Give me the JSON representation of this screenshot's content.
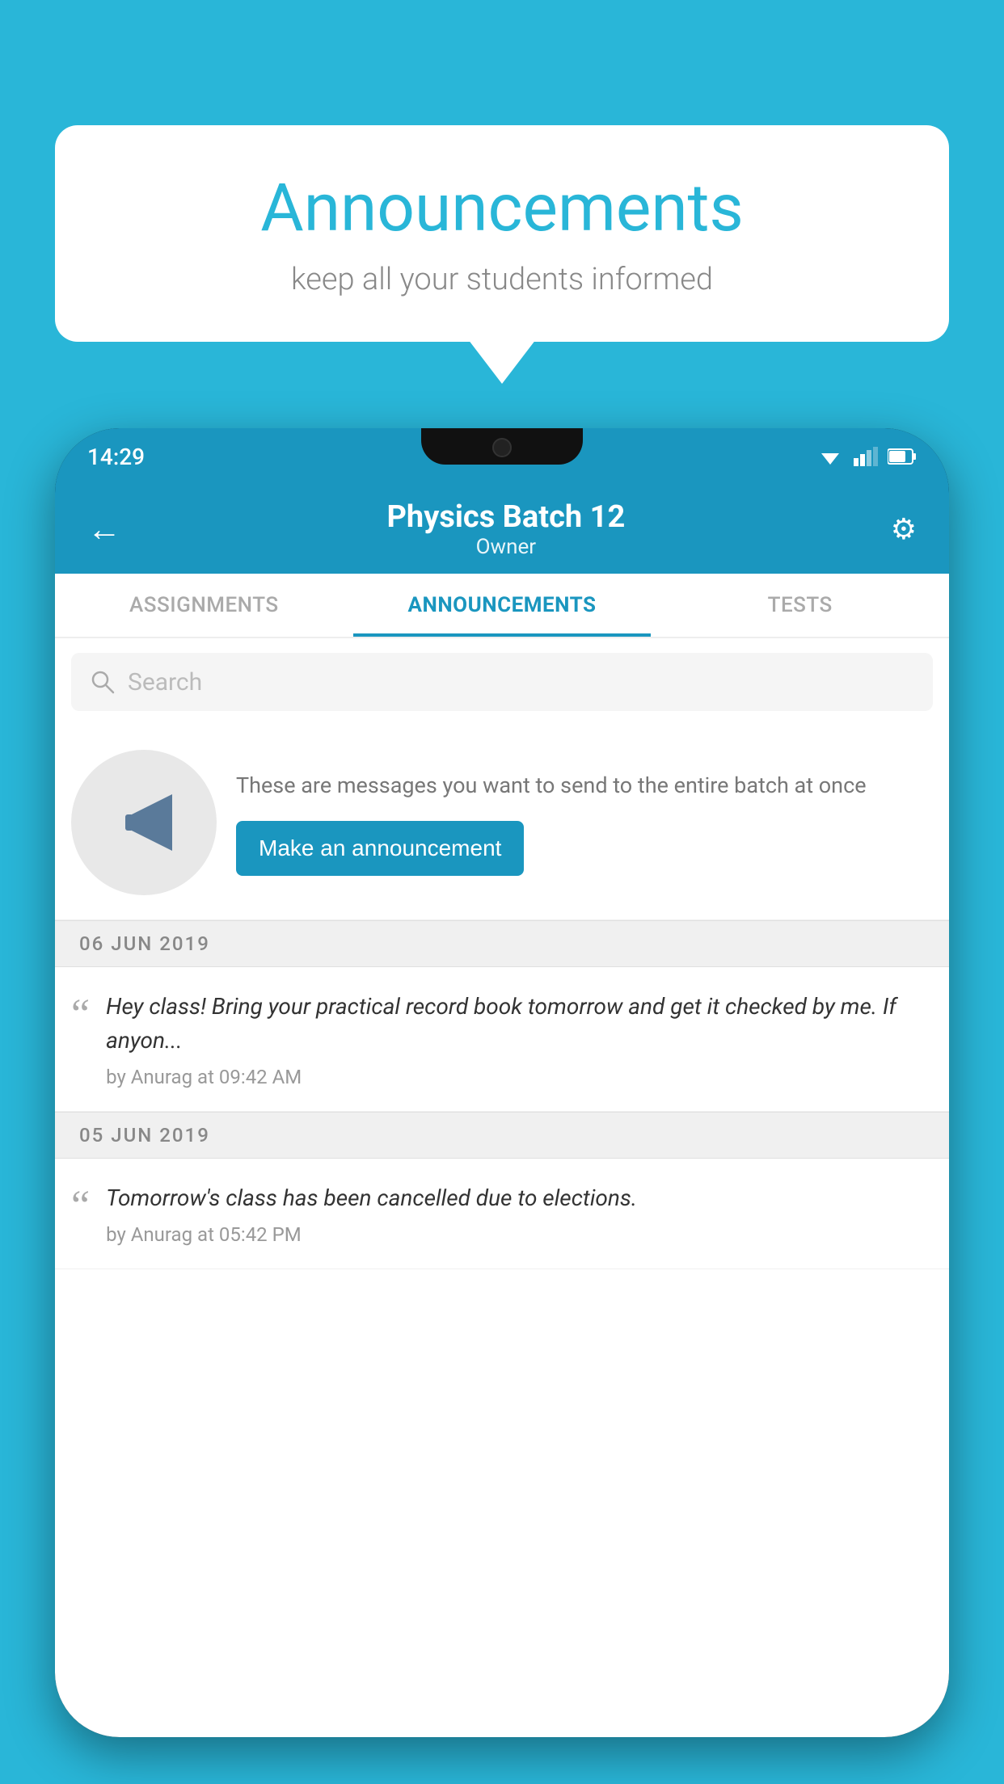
{
  "background": {
    "color": "#29b6d8"
  },
  "speech_bubble": {
    "title": "Announcements",
    "subtitle": "keep all your students informed"
  },
  "phone": {
    "status_bar": {
      "time": "14:29"
    },
    "app_bar": {
      "back_label": "←",
      "title": "Physics Batch 12",
      "subtitle": "Owner",
      "settings_label": "⚙"
    },
    "tabs": [
      {
        "label": "ASSIGNMENTS",
        "active": false
      },
      {
        "label": "ANNOUNCEMENTS",
        "active": true
      },
      {
        "label": "TESTS",
        "active": false
      }
    ],
    "search": {
      "placeholder": "Search"
    },
    "empty_state": {
      "description": "These are messages you want to send to the entire batch at once",
      "button_label": "Make an announcement"
    },
    "announcements": [
      {
        "date": "06  JUN  2019",
        "text": "Hey class! Bring your practical record book tomorrow and get it checked by me. If anyon...",
        "meta": "by Anurag at 09:42 AM"
      },
      {
        "date": "05  JUN  2019",
        "text": "Tomorrow's class has been cancelled due to elections.",
        "meta": "by Anurag at 05:42 PM"
      }
    ]
  }
}
